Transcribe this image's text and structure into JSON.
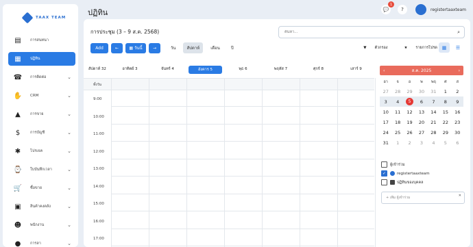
{
  "brand": {
    "name": "TAAX TEAM",
    "color": "#2a6fd1"
  },
  "page": {
    "title": "ปฏิทิน"
  },
  "sidebar": {
    "items": [
      {
        "label": "การสนทนา",
        "icon": "chat-icon",
        "chevron": false,
        "active": false
      },
      {
        "label": "ปฏิทิน",
        "icon": "calendar-icon",
        "chevron": false,
        "active": true
      },
      {
        "label": "การติดต่อ",
        "icon": "contacts-icon",
        "chevron": true,
        "active": false
      },
      {
        "label": "CRM",
        "icon": "handshake-icon",
        "chevron": true,
        "active": false
      },
      {
        "label": "การขาย",
        "icon": "chart-icon",
        "chevron": true,
        "active": false
      },
      {
        "label": "การบัญชี",
        "icon": "money-icon",
        "chevron": true,
        "active": false
      },
      {
        "label": "โปรเจค",
        "icon": "puzzle-icon",
        "chevron": true,
        "active": false
      },
      {
        "label": "ใบบันทึกเวลา",
        "icon": "timesheet-icon",
        "chevron": true,
        "active": false
      },
      {
        "label": "ซื้อขาย",
        "icon": "cart-icon",
        "chevron": true,
        "active": false
      },
      {
        "label": "สินค้าคงคลัง",
        "icon": "box-icon",
        "chevron": true,
        "active": false
      },
      {
        "label": "พนักงาน",
        "icon": "team-icon",
        "chevron": true,
        "active": false
      },
      {
        "label": "การลา",
        "icon": "person-icon",
        "chevron": true,
        "active": false
      }
    ]
  },
  "topbar": {
    "notif_count": "1",
    "username": "registertaaxteam"
  },
  "calendar": {
    "title": "การประชุม (3 – 9 ส.ค. 2568)",
    "search_placeholder": "ค้นหา...",
    "add_label": "Add",
    "today_label": "วันนี้",
    "views": [
      "วัน",
      "สัปดาห์",
      "เดือน",
      "ปี"
    ],
    "active_view": "สัปดาห์",
    "filter_label": "ตัวกรอง",
    "favorites_label": "รายการโปรด",
    "days": [
      "อาทิตย์ 3",
      "จันทร์ 4",
      "อังคาร 5",
      "พุธ 6",
      "พฤหัส 7",
      "ศุกร์ 8",
      "เสาร์ 9"
    ],
    "week_label": "สัปดาห์ 32",
    "today_index": 2,
    "allday_label": "ทั้งวัน",
    "hours": [
      "9:00",
      "10:00",
      "11:00",
      "12:00",
      "13:00",
      "14:00",
      "15:00",
      "16:00",
      "17:00"
    ]
  },
  "mini_calendar": {
    "month_label": "ส.ค. 2025",
    "dow": [
      "อา",
      "จ",
      "อ",
      "พ",
      "พฤ",
      "ศ",
      "ส"
    ],
    "weeks": [
      [
        "27",
        "28",
        "29",
        "30",
        "31",
        "1",
        "2"
      ],
      [
        "3",
        "4",
        "5",
        "6",
        "7",
        "8",
        "9"
      ],
      [
        "10",
        "11",
        "12",
        "13",
        "14",
        "15",
        "16"
      ],
      [
        "17",
        "18",
        "19",
        "20",
        "21",
        "22",
        "23"
      ],
      [
        "24",
        "25",
        "26",
        "27",
        "28",
        "29",
        "30"
      ],
      [
        "31",
        "1",
        "2",
        "3",
        "4",
        "5",
        "6"
      ]
    ],
    "selected": "5",
    "accent": "#e96b5c"
  },
  "attendees": {
    "header": "ผู้เข้าร่วม",
    "items": [
      {
        "label": "registertaaxteam",
        "checked": true
      },
      {
        "label": "ปฏิทินของบุคคล",
        "checked": false
      }
    ],
    "add_placeholder": "+ เพิ่ม ผู้เข้าร่วม"
  }
}
